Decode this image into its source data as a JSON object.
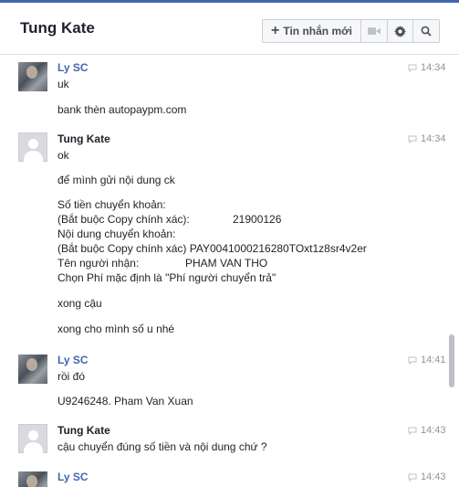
{
  "header": {
    "title": "Tung Kate",
    "new_message_label": "Tin nhắn mới"
  },
  "messages": [
    {
      "sender": "Ly SC",
      "time": "14:34",
      "lines": [
        "uk",
        "bank thèn autopaypm.com"
      ]
    },
    {
      "sender": "Tung Kate",
      "time": "14:34",
      "lines": [
        "ok",
        "để mình gửi nội dung ck",
        "Số tiền chuyển khoản:",
        "(Bắt buộc Copy chính xác):",
        "21900126",
        "Nội dung chuyển khoản:",
        "(Bắt buộc Copy chính xác) PAY0041000216280TOxt1z8sr4v2er",
        "Tên người nhận:",
        "PHAM VAN THO",
        "Chọn Phí mặc định là \"Phí người chuyển trả\"",
        "xong cậu",
        "xong cho mình số u nhé"
      ]
    },
    {
      "sender": "Ly SC",
      "time": "14:41",
      "lines": [
        "rồi đó",
        "U9246248. Pham Van Xuan"
      ]
    },
    {
      "sender": "Tung Kate",
      "time": "14:43",
      "lines": [
        "cậu chuyển đúng số tiền và nội dung chứ ?"
      ]
    },
    {
      "sender": "Ly SC",
      "time": "14:43",
      "lines": []
    }
  ]
}
